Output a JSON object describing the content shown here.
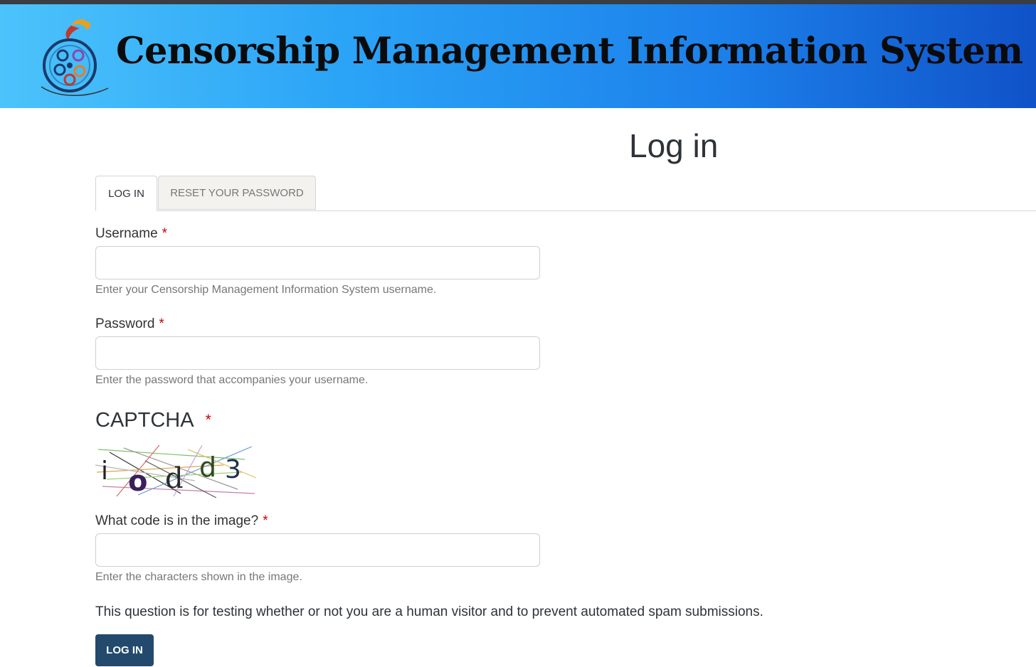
{
  "header": {
    "site_title": "Censorship Management Information System",
    "brand_colors": {
      "banner_start": "#4cc3fb",
      "banner_end": "#1052c8",
      "button": "#234a6d",
      "required": "#cc0000"
    },
    "logo_icon": "film-reel-bird-logo-icon"
  },
  "page": {
    "title": "Log in"
  },
  "tabs": [
    {
      "label": "LOG IN",
      "active": true
    },
    {
      "label": "RESET YOUR PASSWORD",
      "active": false
    }
  ],
  "form": {
    "username": {
      "label": "Username",
      "required_mark": "*",
      "value": "",
      "help": "Enter your Censorship Management Information System username."
    },
    "password": {
      "label": "Password",
      "required_mark": "*",
      "value": "",
      "help": "Enter the password that accompanies your username."
    },
    "captcha": {
      "heading": "CAPTCHA",
      "required_mark": "*",
      "image_text": "iodd3",
      "code_label": "What code is in the image?",
      "code_value": "",
      "help": "Enter the characters shown in the image.",
      "notice": "This question is for testing whether or not you are a human visitor and to prevent automated spam submissions."
    },
    "submit_label": "LOG IN"
  }
}
